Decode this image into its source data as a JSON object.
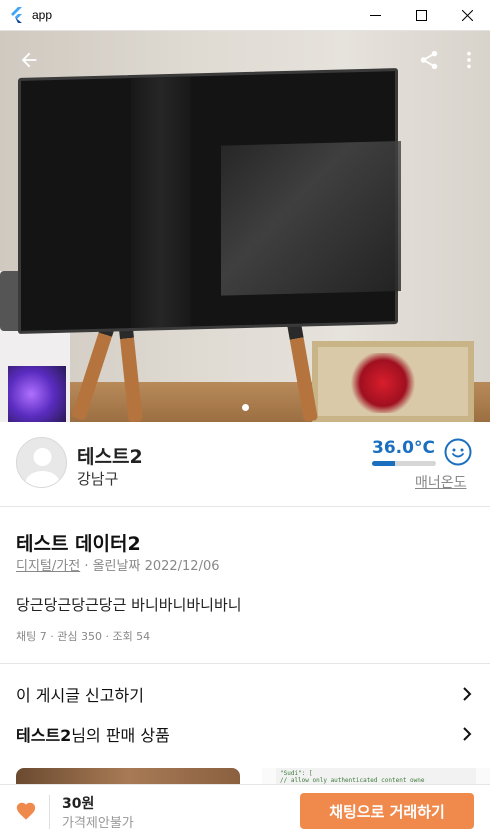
{
  "window": {
    "title": "app",
    "icon": "flutter-icon",
    "controls": [
      "minimize",
      "maximize",
      "close"
    ]
  },
  "hero": {
    "image_description_icon": "product-photo",
    "back_icon": "arrow-back-icon",
    "share_icon": "share-icon",
    "more_icon": "more-vert-icon",
    "page_indicator_count": 1,
    "page_indicator_active": 0
  },
  "seller": {
    "name": "테스트2",
    "location": "강남구",
    "temperature": "36.0°C",
    "temperature_fraction": 0.36,
    "temperature_color": "#1a6fbf",
    "manner_label": "매너온도",
    "manner_icon": "smile-face-icon"
  },
  "post": {
    "title": "테스트 데이터2",
    "category": "디지털/가전",
    "posted": "· 올린날짜 2022/12/06",
    "body": "당근당근당근당근 바니바니바니바니",
    "stats": "채팅 7 · 관심 350 · 조회 54"
  },
  "links": {
    "report": "이 게시글 신고하기",
    "seller_products_name": "테스트2",
    "seller_products_suffix": "님의 판매 상품"
  },
  "thumbs": {
    "code_line1": "\"Sudi\": [",
    "code_line2": "// allow only authenticated content owne"
  },
  "bottom_bar": {
    "price": "30원",
    "negotiation": "가격제안불가",
    "chat_button": "채팅으로 거래하기",
    "accent_color": "#f0894c"
  }
}
